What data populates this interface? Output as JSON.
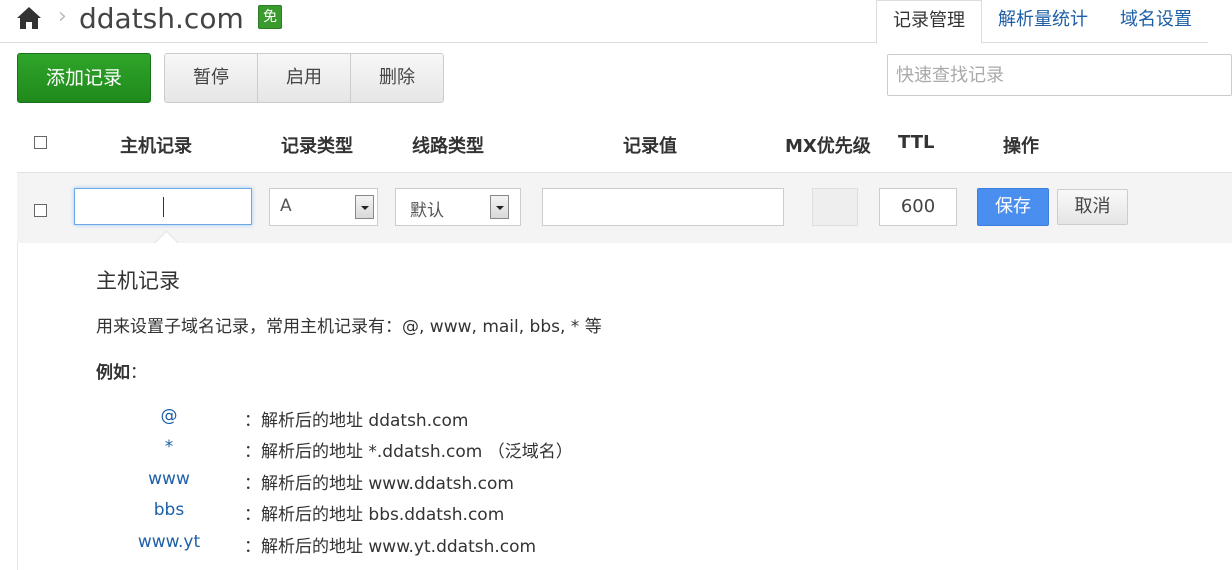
{
  "header": {
    "domain": "ddatsh.com",
    "breadcrumb_sep": "›",
    "free_badge": "免"
  },
  "tabs": [
    {
      "label": "记录管理",
      "active": true
    },
    {
      "label": "解析量统计",
      "active": false
    },
    {
      "label": "域名设置",
      "active": false
    }
  ],
  "toolbar": {
    "add_label": "添加记录",
    "pause_label": "暂停",
    "enable_label": "启用",
    "delete_label": "删除",
    "search_placeholder": "快速查找记录"
  },
  "table": {
    "columns": [
      "主机记录",
      "记录类型",
      "线路类型",
      "记录值",
      "MX优先级",
      "TTL",
      "操作"
    ]
  },
  "edit_row": {
    "host_value": "",
    "record_type": "A",
    "line_type": "默认",
    "record_value": "",
    "mx_value": "",
    "ttl_value": "600",
    "save_label": "保存",
    "cancel_label": "取消"
  },
  "help": {
    "title": "主机记录",
    "description": "用来设置子域名记录，常用主机记录有：@, www, mail, bbs, * 等",
    "example_label": "例如",
    "example_colon": "：",
    "examples": [
      {
        "key": "@",
        "desc": "：解析后的地址 ddatsh.com"
      },
      {
        "key": "*",
        "desc": "：解析后的地址 *.ddatsh.com （泛域名）"
      },
      {
        "key": "www",
        "desc": "：解析后的地址 www.ddatsh.com"
      },
      {
        "key": "bbs",
        "desc": "：解析后的地址 bbs.ddatsh.com"
      },
      {
        "key": "www.yt",
        "desc": "：解析后的地址 www.yt.ddatsh.com"
      }
    ]
  },
  "colors": {
    "primary_green": "#1f8a1b",
    "link_blue": "#1d5fa8",
    "save_blue": "#4a8ff0"
  }
}
